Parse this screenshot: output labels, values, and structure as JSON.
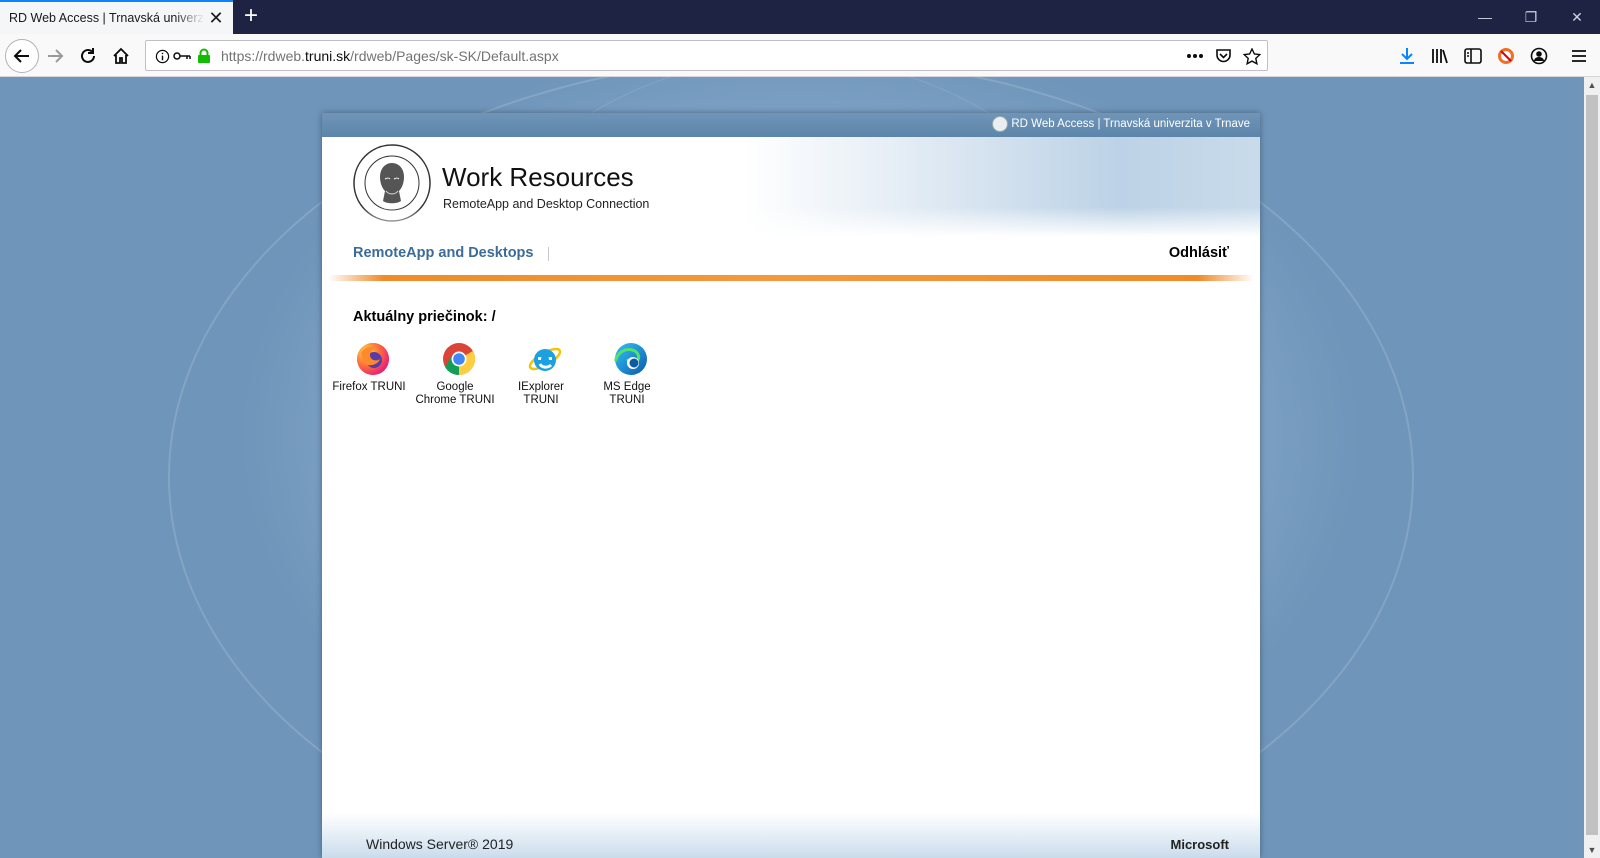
{
  "browser": {
    "tab_title": "RD Web Access | Trnavská univerzita v Trnave",
    "url_prefix": "https://rdweb.",
    "url_host": "truni.sk",
    "url_suffix": "/rdweb/Pages/sk-SK/Default.aspx"
  },
  "panel": {
    "top_bar_text": "RD Web Access | Trnavská univerzita v Trnave",
    "title": "Work Resources",
    "subtitle": "RemoteApp and Desktop Connection",
    "nav_link": "RemoteApp and Desktops",
    "logout": "Odhlásiť",
    "folder_label": "Aktuálny priečinok: /",
    "apps": [
      {
        "label": "Firefox TRUNI",
        "icon": "firefox-icon"
      },
      {
        "label": "Google Chrome TRUNI",
        "icon": "chrome-icon"
      },
      {
        "label": "IExplorer TRUNI",
        "icon": "ie-icon"
      },
      {
        "label": "MS Edge TRUNI",
        "icon": "edge-icon"
      }
    ],
    "footer_left": "Windows Server® 2019",
    "footer_right": "Microsoft"
  },
  "colors": {
    "tabbar_bg": "#1f2343",
    "accent": "#0a84ff",
    "nav_link": "#3c6b9a",
    "orange_line": "#f08b28"
  }
}
